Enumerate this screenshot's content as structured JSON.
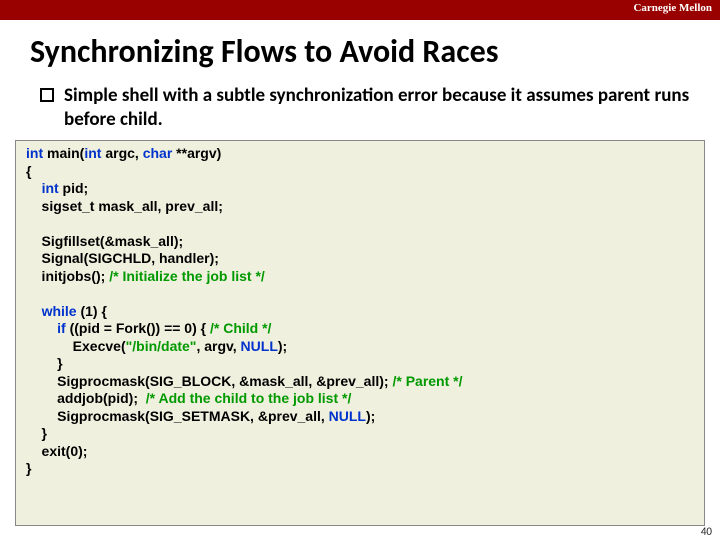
{
  "university": "Carnegie Mellon",
  "title": "Synchronizing Flows to Avoid Races",
  "bullet": "Simple shell with a subtle synchronization error because it assumes parent runs before child.",
  "code": {
    "l1a": "int",
    "l1b": " main(",
    "l1c": "int",
    "l1d": " argc, ",
    "l1e": "char",
    "l1f": " **argv)",
    "l2": "{",
    "l3a": "    ",
    "l3b": "int",
    "l3c": " pid;",
    "l4": "    sigset_t mask_all, prev_all;",
    "blank1": " ",
    "l5": "    Sigfillset(&mask_all);",
    "l6": "    Signal(SIGCHLD, handler);",
    "l7a": "    initjobs(); ",
    "l7b": "/* Initialize the job list */",
    "blank2": " ",
    "l8a": "    ",
    "l8b": "while",
    "l8c": " (1) {",
    "l9a": "        ",
    "l9b": "if",
    "l9c": " ((pid = Fork()) == 0) { ",
    "l9d": "/* Child */",
    "l10a": "            Execve(",
    "l10b": "\"/bin/date\"",
    "l10c": ", argv, ",
    "l10d": "NULL",
    "l10e": ");",
    "l11": "        }",
    "l12a": "        Sigprocmask(SIG_BLOCK, &mask_all, &prev_all); ",
    "l12b": "/* Parent */",
    "l13a": "        addjob(pid);  ",
    "l13b": "/* Add the child to the job list */",
    "l14a": "        Sigprocmask(SIG_SETMASK, &prev_all, ",
    "l14b": "NULL",
    "l14c": ");",
    "l15": "    }",
    "l16": "    exit(0);",
    "l17": "}"
  },
  "pagenum": "40"
}
